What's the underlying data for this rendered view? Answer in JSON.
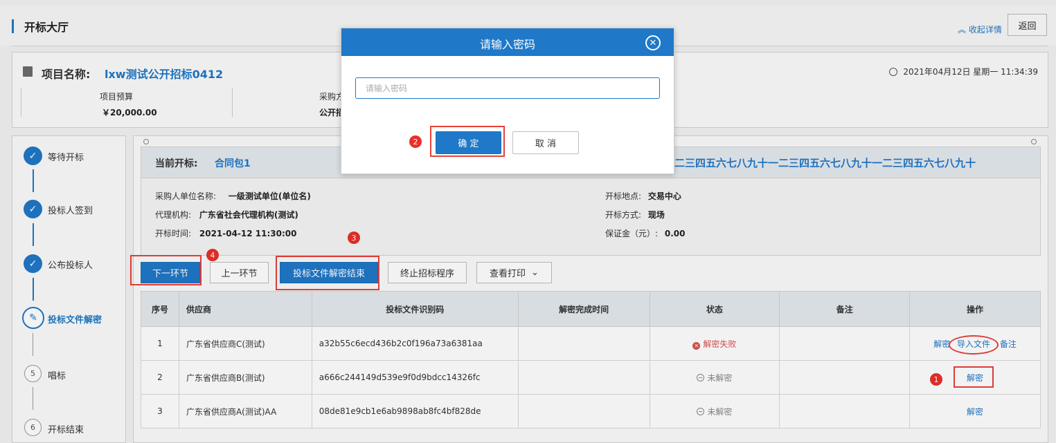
{
  "header": {
    "title": "开标大厅",
    "collapse_label": "收起详情",
    "back_label": "返回"
  },
  "project": {
    "name_label": "项目名称:",
    "name_value": "lxw测试公开招标0412",
    "datetime": "2021年04月12日 星期一 11:34:39",
    "budget_label": "项目预算",
    "budget_value": "￥20,000.00",
    "method_label": "采购方",
    "method_value": "公开招"
  },
  "steps": [
    {
      "label": "等待开标",
      "state": "done"
    },
    {
      "label": "投标人签到",
      "state": "done"
    },
    {
      "label": "公布投标人",
      "state": "done"
    },
    {
      "label": "投标文件解密",
      "state": "active"
    },
    {
      "label": "唱标",
      "state": "pending",
      "number": "5"
    },
    {
      "label": "开标结束",
      "state": "pending",
      "number": "6"
    }
  ],
  "current_bid": {
    "label": "当前开标:",
    "value": "合同包1",
    "tail_text": "二三四五六七八九十一二三四五六七八九十一二三四五六七八九十"
  },
  "bid_info": {
    "buyer_label": "采购人单位名称:",
    "buyer_value": "一级测试单位(单位名)",
    "agency_label": "代理机构:",
    "agency_value": "广东省社会代理机构(测试)",
    "time_label": "开标时间:",
    "time_value": "2021-04-12 11:30:00",
    "place_label": "开标地点:",
    "place_value": "交易中心",
    "mode_label": "开标方式:",
    "mode_value": "现场",
    "deposit_label": "保证金（元）:",
    "deposit_value": "0.00"
  },
  "actions": {
    "next": "下一环节",
    "prev": "上一环节",
    "finish_decrypt": "投标文件解密结束",
    "terminate": "终止招标程序",
    "print": "查看打印"
  },
  "table": {
    "headers": [
      "序号",
      "供应商",
      "投标文件识别码",
      "解密完成时间",
      "状态",
      "备注",
      "操作"
    ],
    "rows": [
      {
        "no": "1",
        "supplier": "广东省供应商C(测试)",
        "code": "a32b55c6ecd436b2c0f196a73a6381aa",
        "time": "",
        "status": "解密失败",
        "note": "",
        "ops": [
          "解密",
          "导入文件",
          "备注"
        ]
      },
      {
        "no": "2",
        "supplier": "广东省供应商B(测试)",
        "code": "a666c244149d539e9f0d9bdcc14326fc",
        "time": "",
        "status": "未解密",
        "note": "",
        "ops": [
          "解密"
        ]
      },
      {
        "no": "3",
        "supplier": "广东省供应商A(测试)AA",
        "code": "08de81e9cb1e6ab9898ab8fc4bf828de",
        "time": "",
        "status": "未解密",
        "note": "",
        "ops": [
          "解密"
        ]
      }
    ]
  },
  "annotations": {
    "b1": "1",
    "b2": "2",
    "b3": "3",
    "b4": "4"
  },
  "modal": {
    "title": "请输入密码",
    "placeholder": "请输入密码",
    "confirm": "确 定",
    "cancel": "取 消"
  },
  "colors": {
    "primary": "#1f78c8",
    "annotation_red": "#e8403a"
  }
}
